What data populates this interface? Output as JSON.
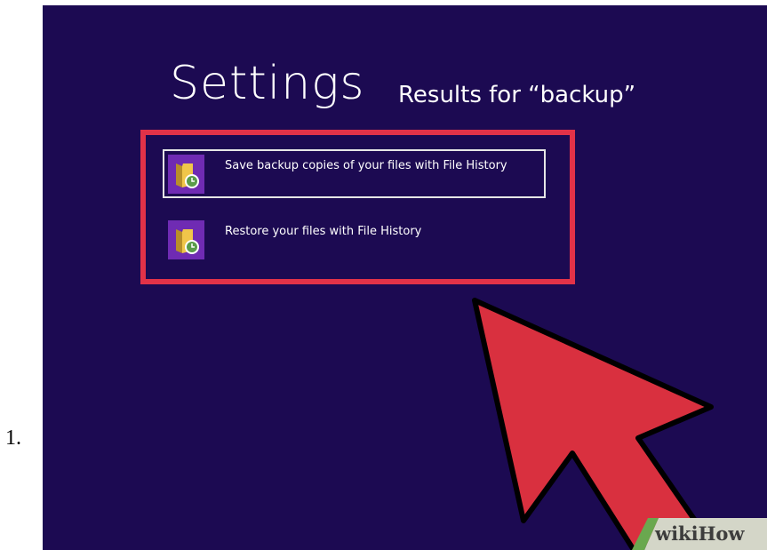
{
  "step": {
    "number": "1."
  },
  "header": {
    "title": "Settings",
    "subtitle": "Results for “backup”"
  },
  "results": [
    {
      "label": "Save backup copies of your files with File History",
      "selected": true,
      "icon": "file-history-icon"
    },
    {
      "label": "Restore your files with File History",
      "selected": false,
      "icon": "file-history-icon"
    }
  ],
  "watermark": {
    "text": "wikiHow"
  },
  "colors": {
    "background": "#1c0a52",
    "highlight": "#e23248",
    "tile": "#6f2bb3",
    "arrow": "#d9303f"
  }
}
